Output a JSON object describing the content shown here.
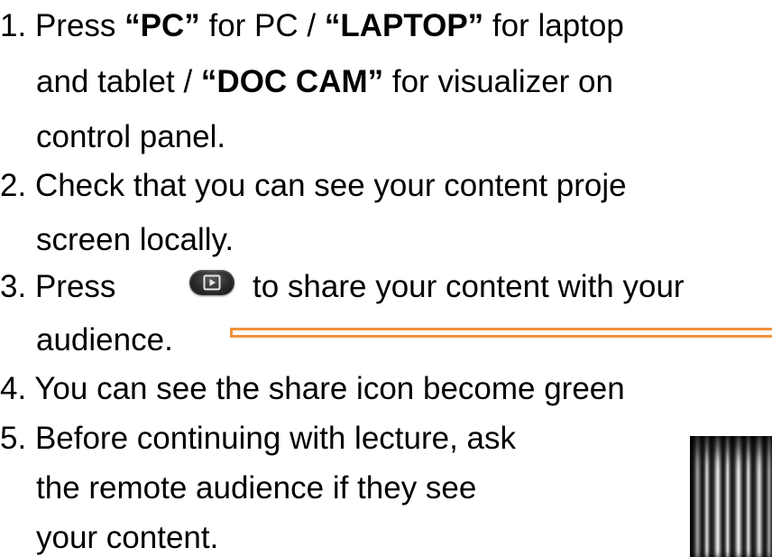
{
  "steps": [
    {
      "number": "1.",
      "line1_pre": "Press ",
      "pc": "“PC”",
      "line1_mid1": " for PC / ",
      "laptop": "“LAPTOP”",
      "line1_mid2": " for laptop",
      "line2_pre": "and tablet / ",
      "doccam": "“DOC CAM”",
      "line2_post": " for visualizer on",
      "line3": "control panel."
    },
    {
      "number": "2.",
      "line1": "Check that you can see your content proje",
      "line2": "screen locally."
    },
    {
      "number": "3.",
      "line1_pre": "Press",
      "line1_post": "to share your content with your",
      "line2": "audience."
    },
    {
      "number": "4.",
      "line1": "You can see the share icon become green"
    },
    {
      "number": "5.",
      "line1": "Before continuing with lecture, ask",
      "line2": "the remote audience if they see",
      "line3": "your content."
    }
  ],
  "colors": {
    "highlight_box": "#f0923a",
    "share_button": "#2a2a2a"
  },
  "icons": {
    "share_button": "share-content-icon"
  }
}
